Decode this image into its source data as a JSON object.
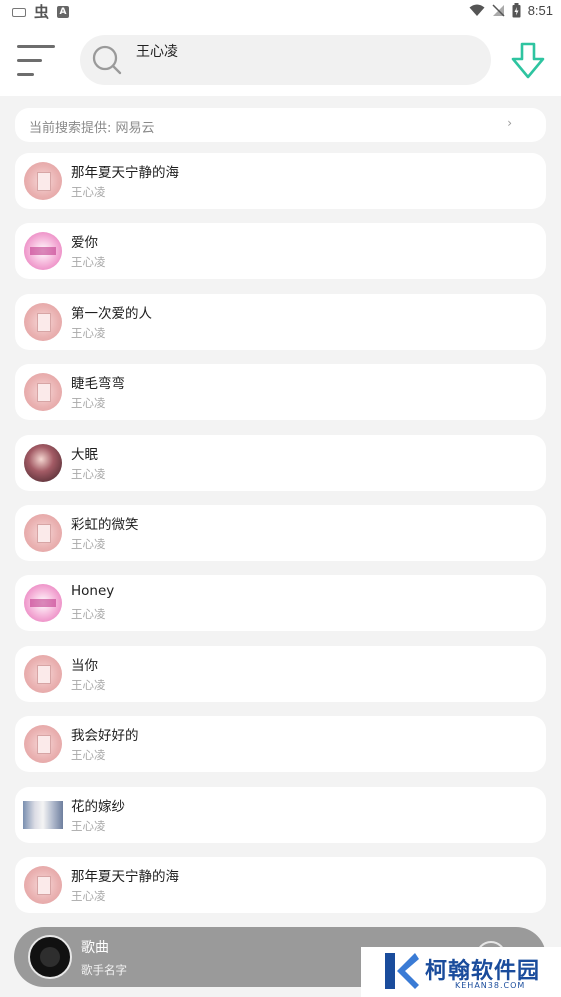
{
  "status_bar": {
    "time": "8:51",
    "notification_a": "A"
  },
  "header": {
    "search_value": "王心凌"
  },
  "source_bar": {
    "text": "当前搜索提供: 网易云",
    "arrow": "›"
  },
  "songs": [
    {
      "title": "那年夏天宁静的海",
      "artist": "王心凌"
    },
    {
      "title": "爱你",
      "artist": "王心凌"
    },
    {
      "title": "第一次爱的人",
      "artist": "王心凌"
    },
    {
      "title": "睫毛弯弯",
      "artist": "王心凌"
    },
    {
      "title": "大眠",
      "artist": "王心凌"
    },
    {
      "title": "彩虹的微笑",
      "artist": "王心凌"
    },
    {
      "title": "Honey",
      "artist": "王心凌"
    },
    {
      "title": "当你",
      "artist": "王心凌"
    },
    {
      "title": "我会好好的",
      "artist": "王心凌"
    },
    {
      "title": "花的嫁纱",
      "artist": "王心凌"
    },
    {
      "title": "那年夏天宁静的海",
      "artist": "王心凌"
    }
  ],
  "player": {
    "title": "歌曲",
    "artist": "歌手名字"
  },
  "watermark": {
    "name": "柯翰软件园",
    "url": "KEHAN38.COM"
  },
  "colors": {
    "accent": "#2ec4a0",
    "player_bg": "#9a9a9a",
    "list_bg": "#f3f3f3"
  },
  "icons": {
    "menu": "menu-icon",
    "search": "search-icon",
    "download": "download-icon",
    "disc": "disc-icon"
  }
}
